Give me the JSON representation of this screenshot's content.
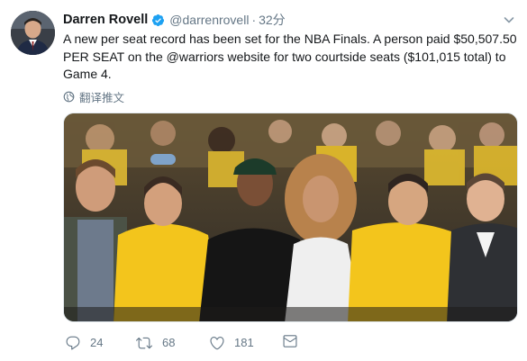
{
  "author": {
    "display_name": "Darren Rovell",
    "handle": "@darrenrovell",
    "separator": "·",
    "time": "32分"
  },
  "tweet": {
    "text": "A new per seat record has been set for the NBA Finals. A person paid $50,507.50 PER SEAT on the @warriors website for two courtside seats ($101,015 total) to Game 4.",
    "translate_label": "翻译推文"
  },
  "actions": {
    "reply_count": "24",
    "retweet_count": "68",
    "like_count": "181"
  },
  "icons": {
    "verified": "verified-badge-icon",
    "caret": "chevron-down-icon",
    "translate": "globe-icon",
    "reply": "reply-icon",
    "retweet": "retweet-icon",
    "like": "heart-icon",
    "dm": "mail-icon"
  },
  "colors": {
    "verified_blue": "#1da1f2",
    "secondary_text": "#657786",
    "primary_text": "#14171a",
    "jersey_yellow": "#f3c51c"
  }
}
